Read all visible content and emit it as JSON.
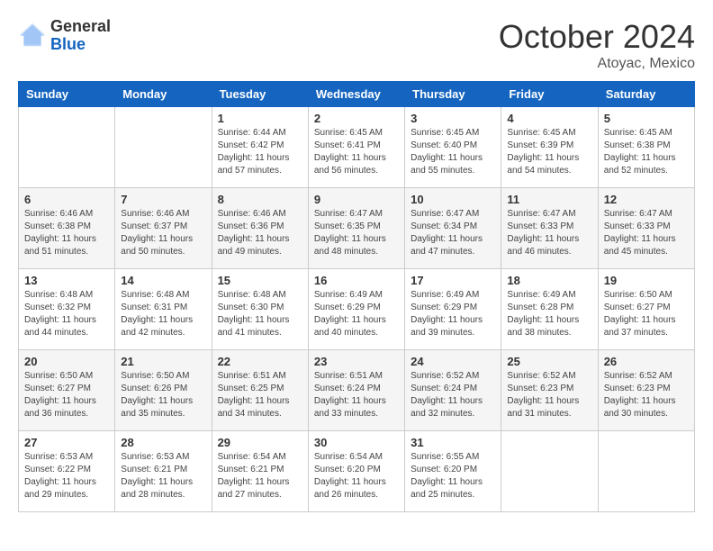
{
  "header": {
    "logo_general": "General",
    "logo_blue": "Blue",
    "month": "October 2024",
    "location": "Atoyac, Mexico"
  },
  "days_of_week": [
    "Sunday",
    "Monday",
    "Tuesday",
    "Wednesday",
    "Thursday",
    "Friday",
    "Saturday"
  ],
  "weeks": [
    [
      {
        "day": "",
        "info": ""
      },
      {
        "day": "",
        "info": ""
      },
      {
        "day": "1",
        "info": "Sunrise: 6:44 AM\nSunset: 6:42 PM\nDaylight: 11 hours and 57 minutes."
      },
      {
        "day": "2",
        "info": "Sunrise: 6:45 AM\nSunset: 6:41 PM\nDaylight: 11 hours and 56 minutes."
      },
      {
        "day": "3",
        "info": "Sunrise: 6:45 AM\nSunset: 6:40 PM\nDaylight: 11 hours and 55 minutes."
      },
      {
        "day": "4",
        "info": "Sunrise: 6:45 AM\nSunset: 6:39 PM\nDaylight: 11 hours and 54 minutes."
      },
      {
        "day": "5",
        "info": "Sunrise: 6:45 AM\nSunset: 6:38 PM\nDaylight: 11 hours and 52 minutes."
      }
    ],
    [
      {
        "day": "6",
        "info": "Sunrise: 6:46 AM\nSunset: 6:38 PM\nDaylight: 11 hours and 51 minutes."
      },
      {
        "day": "7",
        "info": "Sunrise: 6:46 AM\nSunset: 6:37 PM\nDaylight: 11 hours and 50 minutes."
      },
      {
        "day": "8",
        "info": "Sunrise: 6:46 AM\nSunset: 6:36 PM\nDaylight: 11 hours and 49 minutes."
      },
      {
        "day": "9",
        "info": "Sunrise: 6:47 AM\nSunset: 6:35 PM\nDaylight: 11 hours and 48 minutes."
      },
      {
        "day": "10",
        "info": "Sunrise: 6:47 AM\nSunset: 6:34 PM\nDaylight: 11 hours and 47 minutes."
      },
      {
        "day": "11",
        "info": "Sunrise: 6:47 AM\nSunset: 6:33 PM\nDaylight: 11 hours and 46 minutes."
      },
      {
        "day": "12",
        "info": "Sunrise: 6:47 AM\nSunset: 6:33 PM\nDaylight: 11 hours and 45 minutes."
      }
    ],
    [
      {
        "day": "13",
        "info": "Sunrise: 6:48 AM\nSunset: 6:32 PM\nDaylight: 11 hours and 44 minutes."
      },
      {
        "day": "14",
        "info": "Sunrise: 6:48 AM\nSunset: 6:31 PM\nDaylight: 11 hours and 42 minutes."
      },
      {
        "day": "15",
        "info": "Sunrise: 6:48 AM\nSunset: 6:30 PM\nDaylight: 11 hours and 41 minutes."
      },
      {
        "day": "16",
        "info": "Sunrise: 6:49 AM\nSunset: 6:29 PM\nDaylight: 11 hours and 40 minutes."
      },
      {
        "day": "17",
        "info": "Sunrise: 6:49 AM\nSunset: 6:29 PM\nDaylight: 11 hours and 39 minutes."
      },
      {
        "day": "18",
        "info": "Sunrise: 6:49 AM\nSunset: 6:28 PM\nDaylight: 11 hours and 38 minutes."
      },
      {
        "day": "19",
        "info": "Sunrise: 6:50 AM\nSunset: 6:27 PM\nDaylight: 11 hours and 37 minutes."
      }
    ],
    [
      {
        "day": "20",
        "info": "Sunrise: 6:50 AM\nSunset: 6:27 PM\nDaylight: 11 hours and 36 minutes."
      },
      {
        "day": "21",
        "info": "Sunrise: 6:50 AM\nSunset: 6:26 PM\nDaylight: 11 hours and 35 minutes."
      },
      {
        "day": "22",
        "info": "Sunrise: 6:51 AM\nSunset: 6:25 PM\nDaylight: 11 hours and 34 minutes."
      },
      {
        "day": "23",
        "info": "Sunrise: 6:51 AM\nSunset: 6:24 PM\nDaylight: 11 hours and 33 minutes."
      },
      {
        "day": "24",
        "info": "Sunrise: 6:52 AM\nSunset: 6:24 PM\nDaylight: 11 hours and 32 minutes."
      },
      {
        "day": "25",
        "info": "Sunrise: 6:52 AM\nSunset: 6:23 PM\nDaylight: 11 hours and 31 minutes."
      },
      {
        "day": "26",
        "info": "Sunrise: 6:52 AM\nSunset: 6:23 PM\nDaylight: 11 hours and 30 minutes."
      }
    ],
    [
      {
        "day": "27",
        "info": "Sunrise: 6:53 AM\nSunset: 6:22 PM\nDaylight: 11 hours and 29 minutes."
      },
      {
        "day": "28",
        "info": "Sunrise: 6:53 AM\nSunset: 6:21 PM\nDaylight: 11 hours and 28 minutes."
      },
      {
        "day": "29",
        "info": "Sunrise: 6:54 AM\nSunset: 6:21 PM\nDaylight: 11 hours and 27 minutes."
      },
      {
        "day": "30",
        "info": "Sunrise: 6:54 AM\nSunset: 6:20 PM\nDaylight: 11 hours and 26 minutes."
      },
      {
        "day": "31",
        "info": "Sunrise: 6:55 AM\nSunset: 6:20 PM\nDaylight: 11 hours and 25 minutes."
      },
      {
        "day": "",
        "info": ""
      },
      {
        "day": "",
        "info": ""
      }
    ]
  ]
}
